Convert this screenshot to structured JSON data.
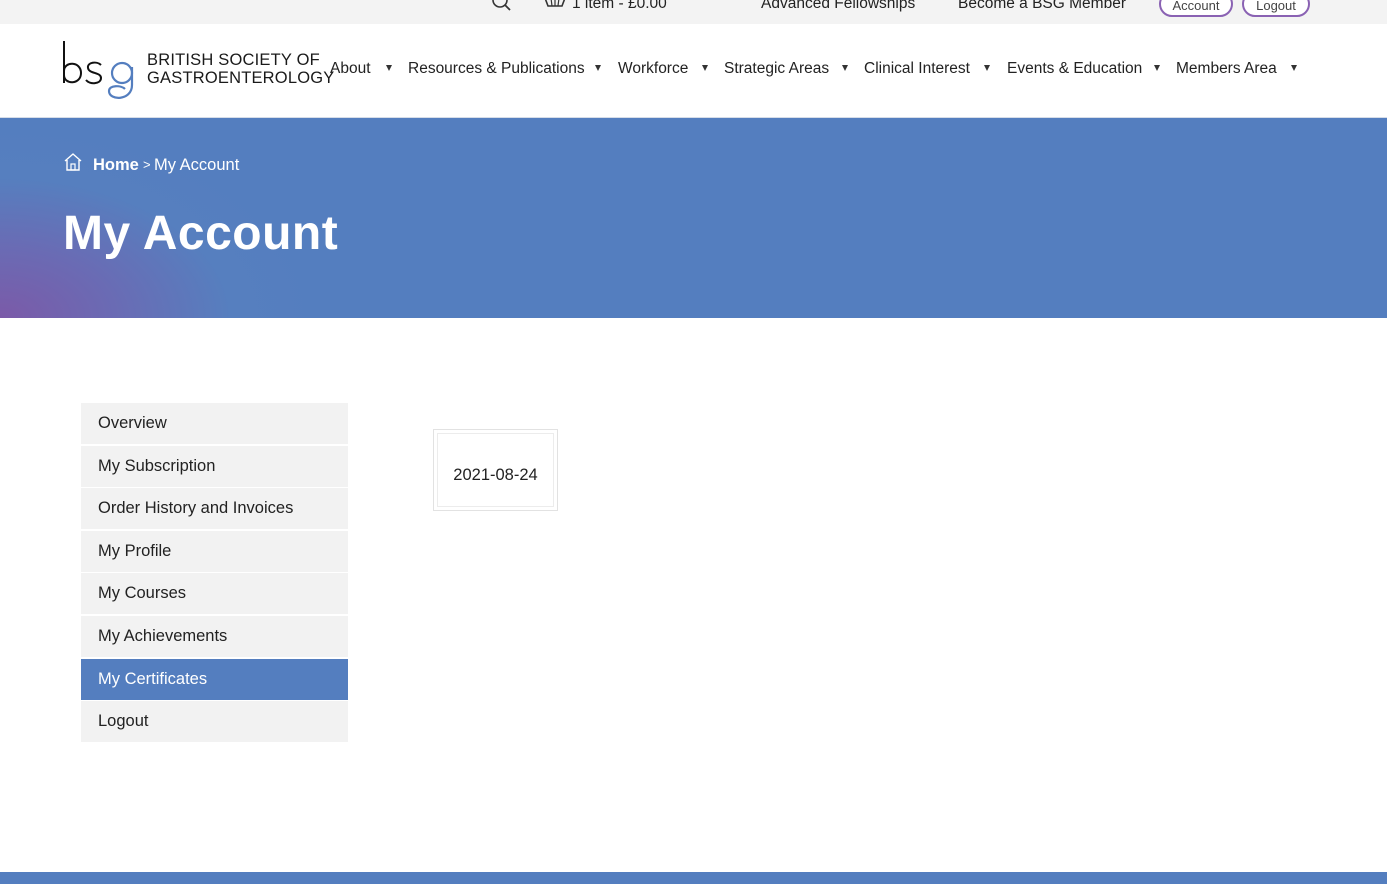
{
  "topbar": {
    "search_icon": "search-icon",
    "cart_icon": "basket-icon",
    "cart_summary": "1 item - £0.00",
    "links": [
      "Advanced Fellowships",
      "Become a BSG Member"
    ],
    "account_button": "Account",
    "logout_button": "Logout"
  },
  "header": {
    "logo_mark": "bsg",
    "org_name_line1": "BRITISH SOCIETY OF",
    "org_name_line2": "GASTROENTEROLOGY",
    "nav": [
      {
        "label": "About"
      },
      {
        "label": "Resources & Publications"
      },
      {
        "label": "Workforce"
      },
      {
        "label": "Strategic Areas"
      },
      {
        "label": "Clinical Interest"
      },
      {
        "label": "Events & Education"
      },
      {
        "label": "Members Area"
      }
    ]
  },
  "hero": {
    "breadcrumb": {
      "home": "Home",
      "separator": ">",
      "current": "My Account"
    },
    "title": "My Account"
  },
  "account_nav": {
    "items": [
      {
        "label": "Overview"
      },
      {
        "label": "My Subscription"
      },
      {
        "label": "Order History and Invoices"
      },
      {
        "label": "My Profile"
      },
      {
        "label": "My Courses"
      },
      {
        "label": "My Achievements"
      },
      {
        "label": "My Certificates"
      },
      {
        "label": "Logout"
      }
    ],
    "active": "My Certificates"
  },
  "certificates": [
    {
      "date": "2021-08-24"
    }
  ],
  "colors": {
    "brand_blue": "#547ebf",
    "brand_purple": "#8a62b3",
    "menu_bg": "#f2f2f2"
  }
}
